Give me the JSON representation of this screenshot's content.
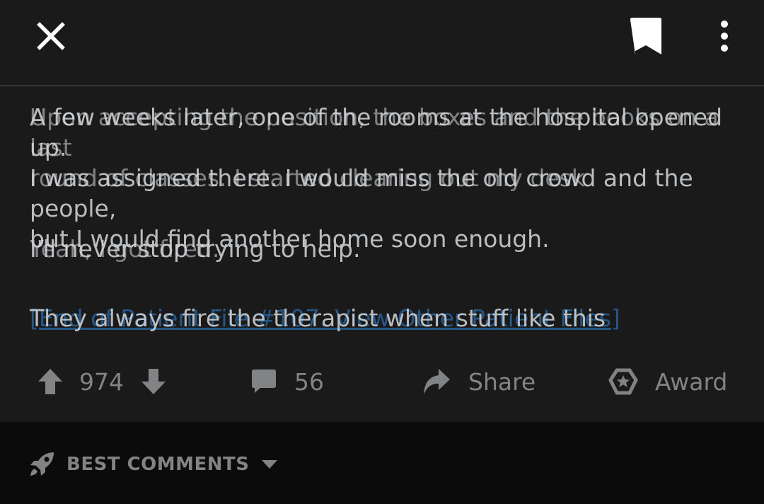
{
  "header": {
    "close_icon": "close-icon",
    "bookmark_icon": "bookmark-icon",
    "more_icon": "more-vertical-icon"
  },
  "post": {
    "layer_a": {
      "p1": "A few weeks later, one of the rooms at the hospital opened up.\nI was assigned there. I would miss the old crowd and the people,\nbut I would find another home soon enough.",
      "p2": "I'll never stop trying to help.",
      "p3": "They always fire the therapist when stuff like this"
    },
    "layer_b": {
      "p1": "Upon accepting the position, the boxes and the books on a last\nround of classes. I started clearing out my desk",
      "p2": "Yeah, I got fired.",
      "p3": "[End of Patient File #107. View Other Patient Files]"
    }
  },
  "actions": {
    "score": "974",
    "comments": "56",
    "share": "Share",
    "award": "Award",
    "upvote_icon": "upvote-arrow-icon",
    "downvote_icon": "downvote-arrow-icon",
    "comment_icon": "comment-bubble-icon",
    "share_icon": "share-arrow-icon",
    "award_icon": "award-icon"
  },
  "comments": {
    "sort_label": "BEST COMMENTS",
    "sort_icon": "rocket-icon",
    "dropdown_icon": "chevron-down-icon"
  },
  "colors": {
    "background": "#1a1a1b",
    "link": "#2f89e0",
    "text": "#d7dadc",
    "muted": "#818384"
  }
}
